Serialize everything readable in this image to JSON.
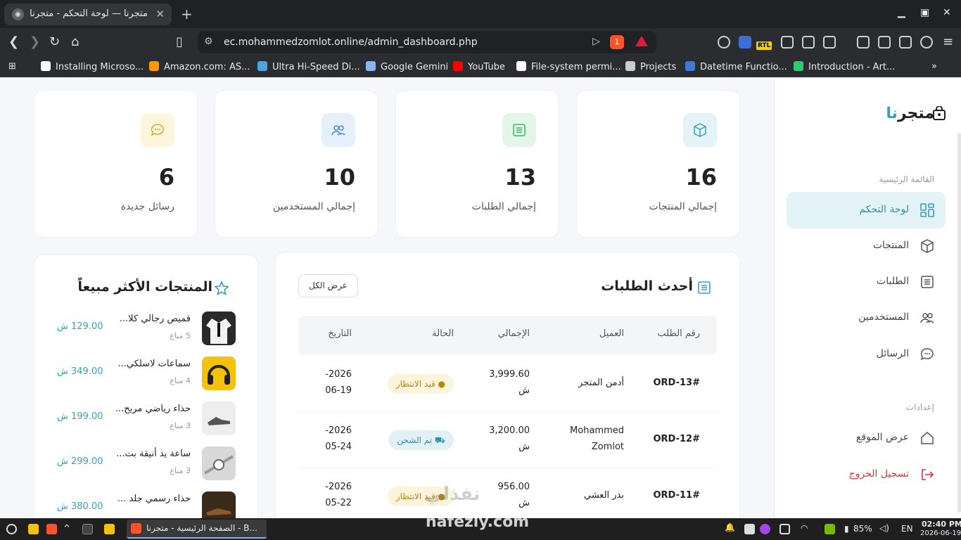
{
  "browser": {
    "tab_title": "متجرنا — لوحة التحكم - متجرنا",
    "url": "ec.mohammedzomlot.online/admin_dashboard.php",
    "brave_count": "1",
    "rtl_badge": "RTL",
    "bookmarks": [
      {
        "label": "Installing Microso...",
        "color": "#ffffff"
      },
      {
        "label": "Amazon.com: AS...",
        "color": "#ff9900"
      },
      {
        "label": "Ultra Hi-Speed Di...",
        "color": "#4fa3e0"
      },
      {
        "label": "Google Gemini",
        "color": "#8ab4f8"
      },
      {
        "label": "YouTube",
        "color": "#ff0000"
      },
      {
        "label": "File-system permi...",
        "color": "#ffffff"
      },
      {
        "label": "Projects",
        "color": "#cccccc"
      },
      {
        "label": "Datetime Functio...",
        "color": "#3b7bd4"
      },
      {
        "label": "Introduction - Art...",
        "color": "#2ecc71"
      }
    ]
  },
  "sidebar": {
    "brand_main": "متجر",
    "brand_accent": "نا",
    "section_main": "القائمة الرئيسية",
    "items": [
      {
        "label": "لوحة التحكم",
        "icon": "dashboard-icon"
      },
      {
        "label": "المنتجات",
        "icon": "box-icon"
      },
      {
        "label": "الطلبات",
        "icon": "orders-icon"
      },
      {
        "label": "المستخدمين",
        "icon": "users-icon"
      },
      {
        "label": "الرسائل",
        "icon": "messages-icon"
      }
    ],
    "section_settings": "إعدادات",
    "view_site": "عرض الموقع",
    "logout": "تسجيل الخروج"
  },
  "stats": [
    {
      "value": "16",
      "label": "إجمالي المنتجات",
      "icon": "box-icon",
      "bg": "#e3f3f7",
      "fg": "#3aa0b8"
    },
    {
      "value": "13",
      "label": "إجمالي الطلبات",
      "icon": "orders-icon",
      "bg": "#e4f6ea",
      "fg": "#3bb56b"
    },
    {
      "value": "10",
      "label": "إجمالي المستخدمين",
      "icon": "users-icon",
      "bg": "#e6f0fb",
      "fg": "#4a8fd8"
    },
    {
      "value": "6",
      "label": "رسائل جديدة",
      "icon": "messages-icon",
      "bg": "#fdf6dc",
      "fg": "#d8a81b"
    }
  ],
  "orders": {
    "title": "أحدث الطلبات",
    "view_all": "عرض الكل",
    "headers": {
      "id": "رقم الطلب",
      "customer": "العميل",
      "total": "الإجمالي",
      "status": "الحالة",
      "date": "التاريخ"
    },
    "rows": [
      {
        "id": "#ORD-13",
        "customer": "أدمن المتجر",
        "total_value": "3,999.60",
        "total_currency": "ش",
        "status": "قيد الانتظار",
        "status_type": "pending",
        "date_year": "2026-",
        "date_md": "06-19"
      },
      {
        "id": "#ORD-12",
        "customer": "Mohammed Zomlot",
        "total_value": "3,200.00",
        "total_currency": "ش",
        "status": "تم الشحن",
        "status_type": "shipped",
        "date_year": "2026-",
        "date_md": "05-24"
      },
      {
        "id": "#ORD-11",
        "customer": "بدر العشي",
        "total_value": "956.00",
        "total_currency": "ش",
        "status": "قيد الانتظار",
        "status_type": "pending",
        "date_year": "2026-",
        "date_md": "05-22"
      }
    ]
  },
  "best_sellers": {
    "title": "المنتجات الأكثر مبيعاً",
    "items": [
      {
        "name": "قميص رجالي كلا...",
        "sold": "5 مباع",
        "price": "129.00 ش",
        "thumb": "#2a2a2a"
      },
      {
        "name": "سماعات لاسلكي...",
        "sold": "4 مباع",
        "price": "349.00 ش",
        "thumb": "#f4c20d"
      },
      {
        "name": "حذاء رياضي مريح...",
        "sold": "3 مباع",
        "price": "199.00 ش",
        "thumb": "#eeeeee"
      },
      {
        "name": "ساعة يد أنيقة بت...",
        "sold": "3 مباع",
        "price": "299.00 ش",
        "thumb": "#d8d8d8"
      },
      {
        "name": "حذاء رسمي جلد ...",
        "sold": "",
        "price": "380.00 ش",
        "thumb": "#3a2a1a"
      }
    ]
  },
  "watermark": {
    "arabic": "نفذلي",
    "latin": "nafezly.com"
  },
  "taskbar": {
    "app_title": "الصفحة الرئيسية - متجرنا - B...",
    "battery": "85%",
    "lang": "EN",
    "time": "02:40 PM",
    "date": "2026-06-19"
  }
}
